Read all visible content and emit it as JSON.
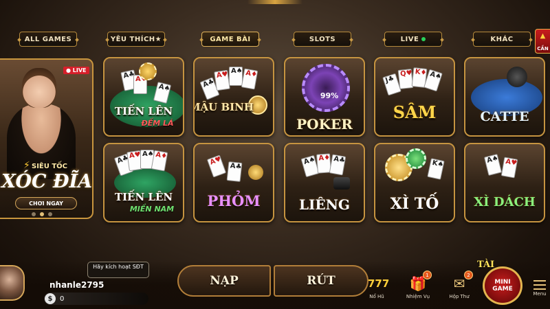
{
  "tabs": [
    {
      "label": "ALL GAMES"
    },
    {
      "label": "YÊU THÍCH★"
    },
    {
      "label": "GAME BÀI",
      "active": true
    },
    {
      "label": "SLOTS"
    },
    {
      "label": "LIVE"
    },
    {
      "label": "KHÁC"
    }
  ],
  "side_flag": {
    "label": "CẦN"
  },
  "feature": {
    "live_badge": "LIVE",
    "speed_label": "SIÊU TỐC",
    "title": "XÓC ĐĨA",
    "play_button": "CHƠI NGAY"
  },
  "games": [
    {
      "title": "TIẾN LÊN",
      "subtitle": "ĐẾM LÁ"
    },
    {
      "title": "MẬU BINH"
    },
    {
      "title": "POKER",
      "badge": "99%"
    },
    {
      "title": "SÂM"
    },
    {
      "title": "CATTE"
    },
    {
      "title": "TIẾN LÊN",
      "subtitle": "MIỀN NAM"
    },
    {
      "title": "PHỎM"
    },
    {
      "title": "LIÊNG"
    },
    {
      "title": "XÌ TỐ"
    },
    {
      "title": "XÌ DÁCH"
    }
  ],
  "player": {
    "activate_text": "Hãy kích hoạt SĐT",
    "username": "nhanle2795",
    "currency_symbol": "$",
    "balance": "0"
  },
  "cash": {
    "deposit": "NẠP",
    "withdraw": "RÚT"
  },
  "nav": {
    "no_hu": "Nổ Hũ",
    "nhiem_vu": "Nhiệm Vụ",
    "nhiem_vu_count": "1",
    "hop_thu": "Hộp Thư",
    "hop_thu_count": "2",
    "tai": "TÀI",
    "mini_game": "MINI GAME",
    "menu": "Menu"
  },
  "colors": {
    "accent_gold": "#c9963e",
    "live_red": "#d61f2a",
    "live_green": "#29d15a"
  }
}
